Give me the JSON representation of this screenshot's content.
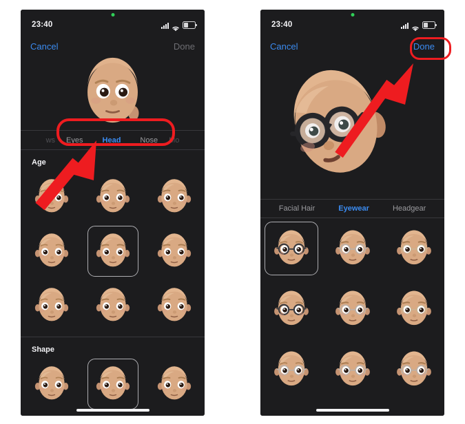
{
  "accent_blue": "#3b8bf0",
  "annotation_red": "#ee1c20",
  "screen_bg": "#1c1c1e",
  "page_bg": "#ffffff",
  "phones": [
    {
      "id": "left",
      "status": {
        "time": "23:40",
        "recording_dot": "green-recording-dot",
        "cellular_icon": "cellular-bars-icon",
        "wifi_icon": "wifi-icon",
        "battery_icon": "battery-icon"
      },
      "nav": {
        "cancel_label": "Cancel",
        "done_label": "Done",
        "done_state": "disabled"
      },
      "preview": {
        "name": "memoji-preview-front",
        "description": "Memoji bald head facing forward"
      },
      "tabbar": {
        "tabs": [
          {
            "label": "ws",
            "state": "edge-partial"
          },
          {
            "label": "Eyes",
            "state": "normal"
          },
          {
            "label": "Head",
            "state": "selected"
          },
          {
            "label": "Nose",
            "state": "normal"
          },
          {
            "label": "Mo",
            "state": "edge-partial"
          }
        ]
      },
      "sections": [
        {
          "title": "Age",
          "rows": 3,
          "selected_index": 4,
          "items": [
            "age-option-1",
            "age-option-2",
            "age-option-3",
            "age-option-4",
            "age-option-5",
            "age-option-6",
            "age-option-7",
            "age-option-8",
            "age-option-9"
          ]
        },
        {
          "title": "Shape",
          "rows": 1,
          "selected_index": 1,
          "items": [
            "shape-option-1",
            "shape-option-2",
            "shape-option-3"
          ]
        }
      ],
      "home_indicator": "home-indicator"
    },
    {
      "id": "right",
      "status": {
        "time": "23:40",
        "recording_dot": "green-recording-dot",
        "cellular_icon": "cellular-bars-icon",
        "wifi_icon": "wifi-icon",
        "battery_icon": "battery-icon"
      },
      "nav": {
        "cancel_label": "Cancel",
        "done_label": "Done",
        "done_state": "enabled"
      },
      "preview": {
        "name": "memoji-preview-glasses",
        "description": "Large Memoji head turned left wearing round black glasses"
      },
      "tabbar": {
        "tabs": [
          {
            "label": "Facial Hair",
            "state": "normal"
          },
          {
            "label": "Eyewear",
            "state": "selected"
          },
          {
            "label": "Headgear",
            "state": "normal"
          }
        ]
      },
      "sections": [
        {
          "title": "",
          "rows": 3,
          "selected_index": 0,
          "items": [
            "eyewear-option-1",
            "eyewear-option-2",
            "eyewear-option-3",
            "eyewear-option-4",
            "eyewear-option-5",
            "eyewear-option-6",
            "eyewear-option-7",
            "eyewear-option-8",
            "eyewear-option-9"
          ]
        }
      ],
      "home_indicator": "home-indicator"
    }
  ],
  "annotations": [
    {
      "name": "highlight-tabbar",
      "type": "rounded-rect",
      "target": "Eyes / Head / Nose tab bar"
    },
    {
      "name": "arrow-to-tabbar",
      "type": "arrow",
      "direction": "up-right",
      "target": "Head tab"
    },
    {
      "name": "highlight-done-button",
      "type": "rounded-rect",
      "target": "Done button"
    },
    {
      "name": "arrow-to-done",
      "type": "arrow",
      "direction": "up-right",
      "target": "Done button"
    }
  ]
}
